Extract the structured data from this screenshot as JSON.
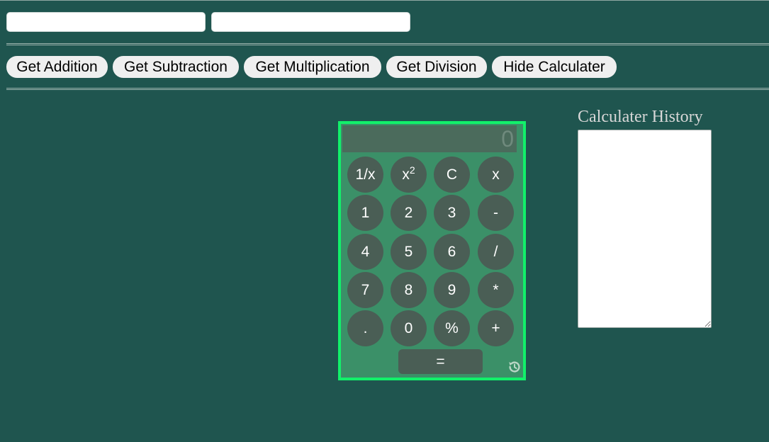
{
  "inputs": {
    "first_value": "",
    "second_value": ""
  },
  "toolbar": {
    "addition_label": "Get Addition",
    "subtraction_label": "Get Subtraction",
    "multiplication_label": "Get Multiplication",
    "division_label": "Get Division",
    "hide_label": "Hide Calculater"
  },
  "calculator": {
    "display": "0",
    "keys": [
      "1/x",
      "x2",
      "C",
      "x",
      "1",
      "2",
      "3",
      "-",
      "4",
      "5",
      "6",
      "/",
      "7",
      "8",
      "9",
      "*",
      ".",
      "0",
      "%",
      "+"
    ],
    "equals_label": "=",
    "history_icon": "history-icon"
  },
  "history": {
    "title": "Calculater History",
    "content": ""
  },
  "colors": {
    "background": "#1f554f",
    "calculator_border": "#12f06a",
    "calculator_body": "#3b9068",
    "key_background": "#4a5e55"
  }
}
